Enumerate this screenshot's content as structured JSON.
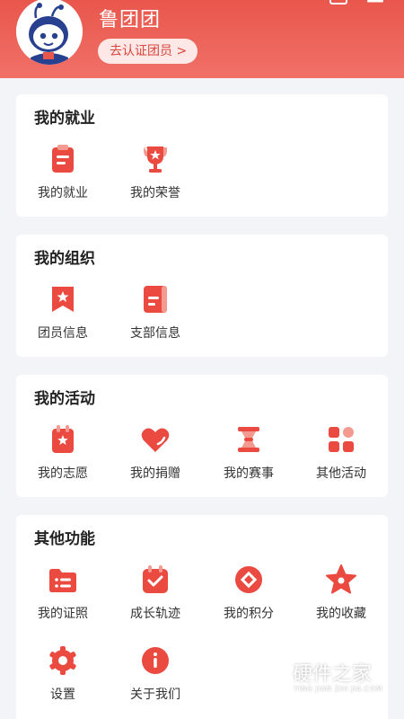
{
  "colors": {
    "brand": "#e9564c",
    "icon": "#ea4a3f",
    "background": "#f3f4f8"
  },
  "header": {
    "username": "鲁团团",
    "verify_label": "去认证团员 >"
  },
  "sections": {
    "employment": {
      "title": "我的就业",
      "items": [
        {
          "label": "我的就业",
          "icon": "clipboard-icon"
        },
        {
          "label": "我的荣誉",
          "icon": "trophy-icon"
        }
      ]
    },
    "organization": {
      "title": "我的组织",
      "items": [
        {
          "label": "团员信息",
          "icon": "member-badge-icon"
        },
        {
          "label": "支部信息",
          "icon": "branch-document-icon"
        }
      ]
    },
    "activity": {
      "title": "我的活动",
      "items": [
        {
          "label": "我的志愿",
          "icon": "volunteer-icon"
        },
        {
          "label": "我的捐赠",
          "icon": "heart-icon"
        },
        {
          "label": "我的赛事",
          "icon": "contest-icon"
        },
        {
          "label": "其他活动",
          "icon": "grid-icon"
        }
      ]
    },
    "other": {
      "title": "其他功能",
      "items": [
        {
          "label": "我的证照",
          "icon": "certificate-folder-icon"
        },
        {
          "label": "成长轨迹",
          "icon": "calendar-check-icon"
        },
        {
          "label": "我的积分",
          "icon": "points-icon"
        },
        {
          "label": "我的收藏",
          "icon": "star-icon"
        },
        {
          "label": "设置",
          "icon": "gear-icon"
        },
        {
          "label": "关于我们",
          "icon": "info-icon"
        }
      ]
    }
  },
  "watermark": {
    "title": "硬件之家",
    "subtitle": "YING JIAN ZHI JIA.COM"
  }
}
